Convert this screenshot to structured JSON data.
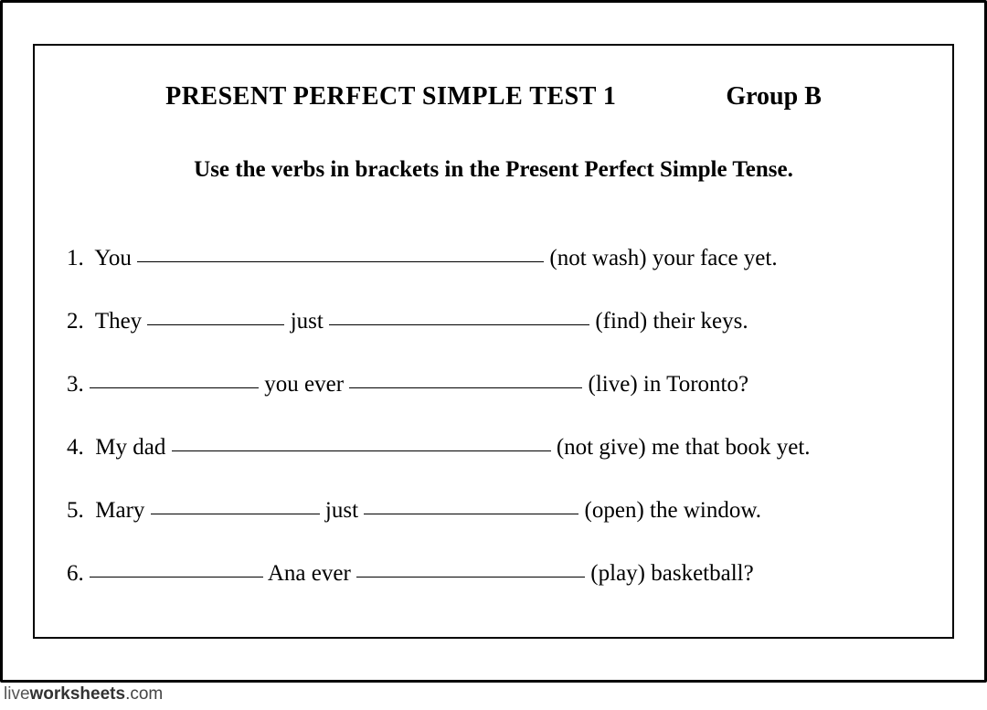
{
  "header": {
    "title": "PRESENT PERFECT SIMPLE  TEST  1",
    "group": "Group  B"
  },
  "instruction": "Use the verbs in brackets in the Present Perfect Simple Tense.",
  "questions": {
    "q1": {
      "num": "1.",
      "pre": "You",
      "hint": "(not  wash) your face yet."
    },
    "q2": {
      "num": "2.",
      "pre": "They",
      "mid": "just",
      "hint": "(find) their keys."
    },
    "q3": {
      "num": "3.",
      "mid": "you  ever",
      "hint": "(live) in Toronto?"
    },
    "q4": {
      "num": "4.",
      "pre": "My dad",
      "hint": "(not  give) me that book yet."
    },
    "q5": {
      "num": "5.",
      "pre": "Mary",
      "mid": "just",
      "hint": "(open)  the window."
    },
    "q6": {
      "num": "6.",
      "mid": "Ana ever",
      "hint": "(play)  basketball?"
    }
  },
  "footer": {
    "part1": "live",
    "part2": "worksheets",
    "part3": ".com"
  }
}
